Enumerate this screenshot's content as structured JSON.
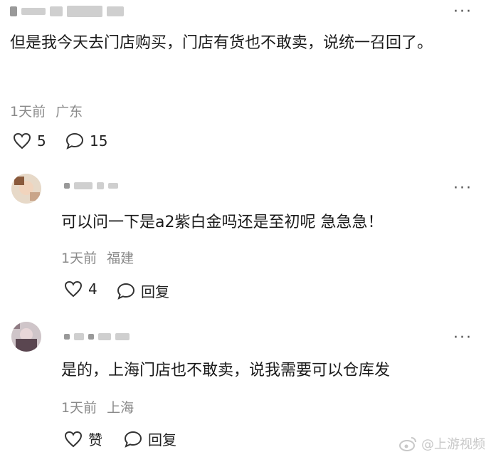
{
  "comments": [
    {
      "text": "但是我今天去门店购买，门店有货也不敢卖，说统一召回了。",
      "time": "1天前",
      "location": "广东",
      "likes": "5",
      "replies": "15"
    },
    {
      "text": "可以问一下是a2紫白金吗还是至初呢 急急急！",
      "time": "1天前",
      "location": "福建",
      "likes": "4",
      "reply_label": "回复"
    },
    {
      "text": "是的，上海门店也不敢卖，说我需要可以仓库发",
      "time": "1天前",
      "location": "上海",
      "like_label": "赞",
      "reply_label": "回复"
    }
  ],
  "watermark": "@上游视频",
  "icons": [
    "more-icon",
    "heart-icon",
    "comment-icon",
    "weibo-logo-icon"
  ]
}
